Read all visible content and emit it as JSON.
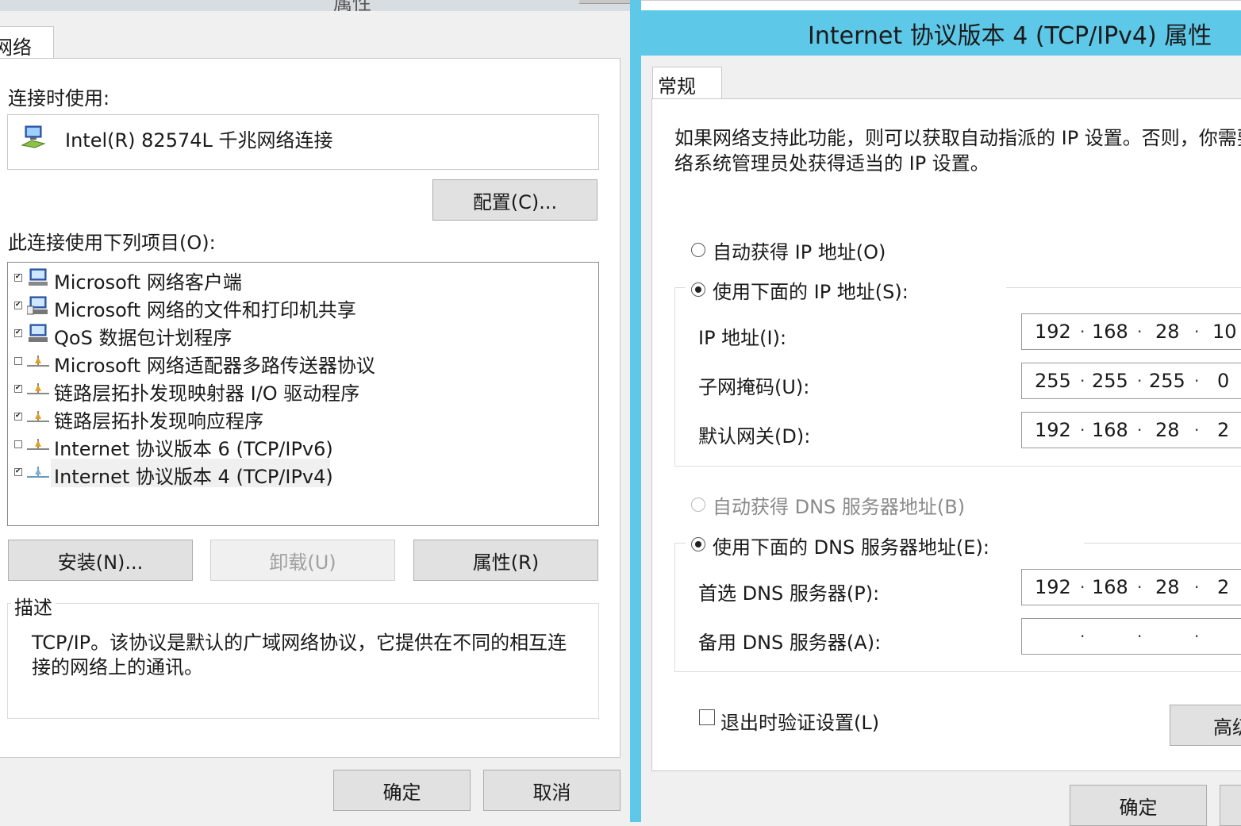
{
  "left": {
    "title_partial": "属性",
    "tab_label": "网络",
    "connect_using_label": "连接时使用:",
    "adapter_name": "Intel(R) 82574L 千兆网络连接",
    "configure_button": "配置(C)...",
    "items_label": "此连接使用下列项目(O):",
    "items": [
      {
        "label": "Microsoft 网络客户端",
        "checked": true,
        "icon": "network-client-icon"
      },
      {
        "label": "Microsoft 网络的文件和打印机共享",
        "checked": true,
        "icon": "file-share-icon"
      },
      {
        "label": "QoS 数据包计划程序",
        "checked": true,
        "icon": "qos-icon"
      },
      {
        "label": "Microsoft 网络适配器多路传送器协议",
        "checked": false,
        "icon": "protocol-icon"
      },
      {
        "label": "链路层拓扑发现映射器 I/O 驱动程序",
        "checked": true,
        "icon": "protocol-icon"
      },
      {
        "label": "链路层拓扑发现响应程序",
        "checked": true,
        "icon": "protocol-icon"
      },
      {
        "label": "Internet 协议版本 6 (TCP/IPv6)",
        "checked": false,
        "icon": "protocol-icon"
      },
      {
        "label": "Internet 协议版本 4 (TCP/IPv4)",
        "checked": true,
        "icon": "protocol-icon"
      }
    ],
    "install_button": "安装(N)...",
    "uninstall_button": "卸载(U)",
    "properties_button": "属性(R)",
    "description_label": "描述",
    "description_line1": "TCP/IP。该协议是默认的广域网络协议，它提供在不同的相互连",
    "description_line2": "接的网络上的通讯。",
    "ok_button": "确定",
    "cancel_button": "取消"
  },
  "right": {
    "title": "Internet 协议版本 4 (TCP/IPv4) 属性",
    "tab_label": "常规",
    "info_line1": "如果网络支持此功能，则可以获取自动指派的 IP 设置。否则，你需要",
    "info_line2": "络系统管理员处获得适当的 IP 设置。",
    "auto_ip_label": "自动获得 IP 地址(O)",
    "manual_ip_label": "使用下面的 IP 地址(S):",
    "ip_label": "IP 地址(I):",
    "ip_value": [
      "192",
      "168",
      "28",
      "10"
    ],
    "mask_label": "子网掩码(U):",
    "mask_value": [
      "255",
      "255",
      "255",
      "0"
    ],
    "gateway_label": "默认网关(D):",
    "gateway_value": [
      "192",
      "168",
      "28",
      "2"
    ],
    "auto_dns_label": "自动获得 DNS 服务器地址(B)",
    "manual_dns_label": "使用下面的 DNS 服务器地址(E):",
    "preferred_dns_label": "首选 DNS 服务器(P):",
    "preferred_dns_value": [
      "192",
      "168",
      "28",
      "2"
    ],
    "alternate_dns_label": "备用 DNS 服务器(A):",
    "alternate_dns_value": [
      "",
      "",
      "",
      ""
    ],
    "validate_label": "退出时验证设置(L)",
    "advanced_button": "高级",
    "ok_button": "确定"
  },
  "colors": {
    "title_bar": "#5ec8e8",
    "dialog_bg": "#f0f0f0",
    "button_bg": "#e1e1e1"
  }
}
